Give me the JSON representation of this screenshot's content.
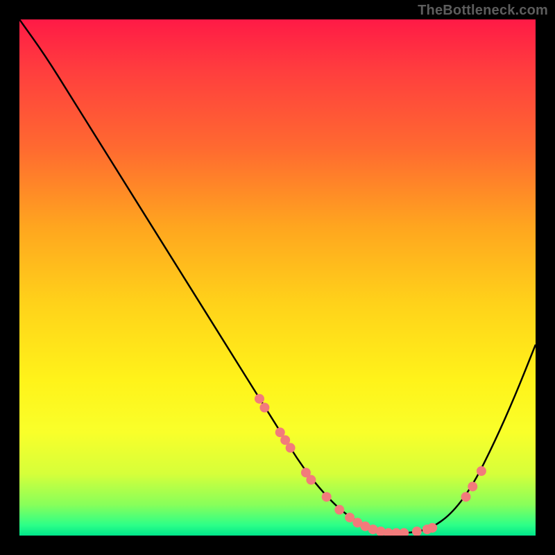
{
  "watermark": "TheBottleneck.com",
  "colors": {
    "background": "#000000",
    "curve": "#000000",
    "dot": "#f27b7b",
    "gradient_top": "#ff1a46",
    "gradient_bottom": "#00e68a"
  },
  "chart_data": {
    "type": "line",
    "title": "",
    "xlabel": "",
    "ylabel": "",
    "xlim": [
      0,
      1
    ],
    "ylim": [
      0,
      1
    ],
    "series": [
      {
        "name": "curve",
        "x": [
          0.0,
          0.05,
          0.1,
          0.15,
          0.2,
          0.25,
          0.3,
          0.35,
          0.4,
          0.45,
          0.5,
          0.55,
          0.6,
          0.64,
          0.68,
          0.72,
          0.76,
          0.8,
          0.84,
          0.88,
          0.92,
          0.96,
          1.0
        ],
        "y": [
          1.0,
          0.93,
          0.85,
          0.77,
          0.69,
          0.61,
          0.53,
          0.45,
          0.37,
          0.29,
          0.21,
          0.13,
          0.07,
          0.035,
          0.015,
          0.005,
          0.005,
          0.015,
          0.045,
          0.1,
          0.18,
          0.27,
          0.37
        ]
      }
    ],
    "markers": [
      {
        "x": 0.465,
        "y": 0.265
      },
      {
        "x": 0.475,
        "y": 0.248
      },
      {
        "x": 0.505,
        "y": 0.2
      },
      {
        "x": 0.515,
        "y": 0.185
      },
      {
        "x": 0.525,
        "y": 0.17
      },
      {
        "x": 0.555,
        "y": 0.122
      },
      {
        "x": 0.565,
        "y": 0.108
      },
      {
        "x": 0.595,
        "y": 0.075
      },
      {
        "x": 0.62,
        "y": 0.05
      },
      {
        "x": 0.64,
        "y": 0.035
      },
      {
        "x": 0.655,
        "y": 0.025
      },
      {
        "x": 0.67,
        "y": 0.018
      },
      {
        "x": 0.685,
        "y": 0.012
      },
      {
        "x": 0.7,
        "y": 0.008
      },
      {
        "x": 0.715,
        "y": 0.005
      },
      {
        "x": 0.73,
        "y": 0.005
      },
      {
        "x": 0.745,
        "y": 0.005
      },
      {
        "x": 0.77,
        "y": 0.008
      },
      {
        "x": 0.79,
        "y": 0.012
      },
      {
        "x": 0.8,
        "y": 0.015
      },
      {
        "x": 0.865,
        "y": 0.075
      },
      {
        "x": 0.878,
        "y": 0.095
      },
      {
        "x": 0.895,
        "y": 0.125
      }
    ],
    "annotations": []
  }
}
